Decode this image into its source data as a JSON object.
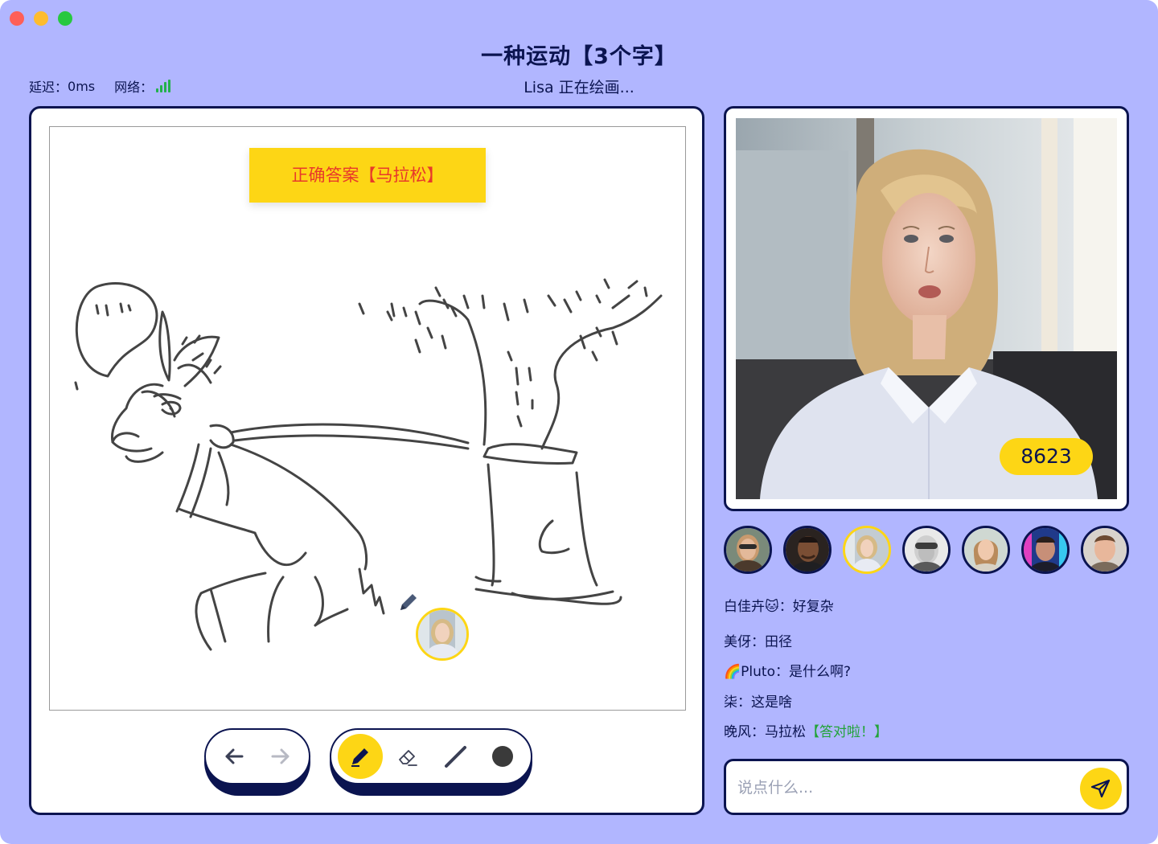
{
  "window": {
    "traffic_lights": [
      "close",
      "minimize",
      "zoom"
    ]
  },
  "header": {
    "title": "一种运动【3个字】",
    "status": "Lisa 正在绘画...",
    "latency_label": "延迟：",
    "latency_value": "0ms",
    "network_label": "网络："
  },
  "canvas": {
    "answer_banner": "正确答案【马拉松】"
  },
  "video": {
    "score": "8623"
  },
  "players": [
    {
      "name": "player-1",
      "active": false
    },
    {
      "name": "player-2",
      "active": false
    },
    {
      "name": "player-3",
      "active": true
    },
    {
      "name": "player-4",
      "active": false
    },
    {
      "name": "player-5",
      "active": false
    },
    {
      "name": "player-6",
      "active": false
    },
    {
      "name": "player-7",
      "active": false
    }
  ],
  "chat": {
    "messages": [
      {
        "user": "白佳卉🐱",
        "sep": "：",
        "text": "好复杂",
        "tag": ""
      },
      {
        "user": "美伢",
        "sep": "：",
        "text": "田径",
        "tag": ""
      },
      {
        "user": "🌈Pluto",
        "sep": "：",
        "text": "是什么啊?",
        "tag": ""
      },
      {
        "user": "柒",
        "sep": "：",
        "text": "这是啥",
        "tag": ""
      },
      {
        "user": "晚风",
        "sep": "：",
        "text": "马拉松",
        "tag": "【答对啦！】"
      }
    ],
    "input_placeholder": "说点什么...",
    "input_value": ""
  },
  "colors": {
    "background": "#b1b6ff",
    "navy": "#0b1450",
    "accent_yellow": "#fdd615",
    "answer_red": "#e8392a",
    "correct_green": "#22a339"
  },
  "icons": {
    "undo": "arrow-left-icon",
    "redo": "arrow-right-icon",
    "pen": "pen-icon",
    "eraser": "eraser-icon",
    "line": "line-icon",
    "fill": "circle-fill-icon",
    "send": "paper-plane-icon"
  }
}
